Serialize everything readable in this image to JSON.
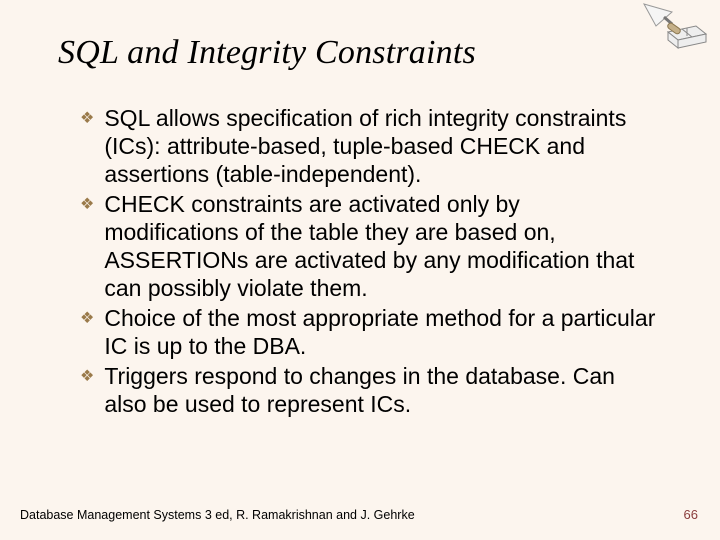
{
  "title": "SQL and Integrity Constraints",
  "bullets": [
    "SQL allows specification of rich integrity constraints (ICs): attribute-based, tuple-based CHECK and assertions (table-independent).",
    "CHECK constraints are activated only by modifications of the table they are based on, ASSERTIONs are activated by any modification that can possibly violate them.",
    "Choice of the most appropriate method for a particular IC is up to the DBA.",
    "Triggers respond to changes in the database. Can also be used to represent ICs."
  ],
  "footer": {
    "left": "Database Management Systems 3 ed,  R. Ramakrishnan and J. Gehrke",
    "right": "66"
  },
  "bullet_glyph": "❖"
}
